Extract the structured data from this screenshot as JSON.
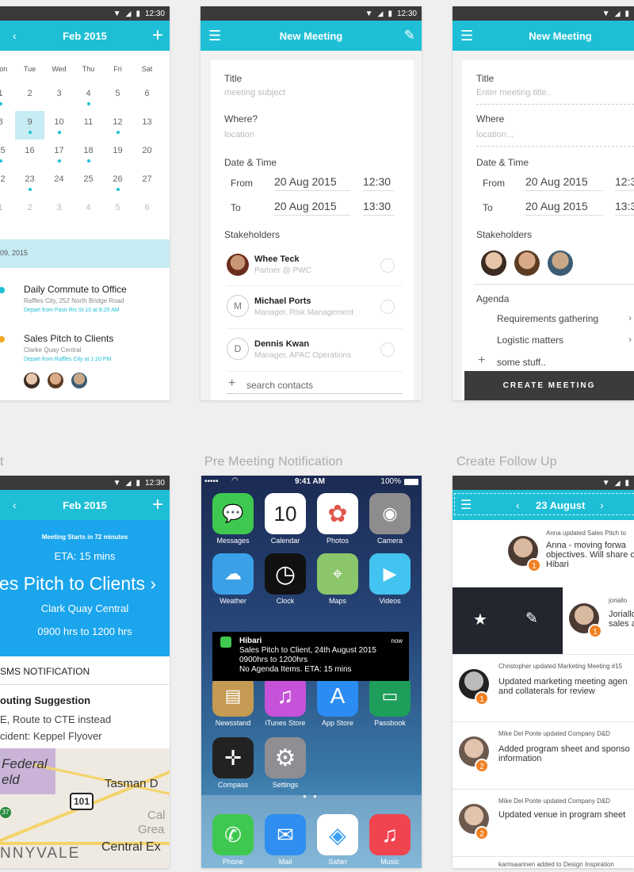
{
  "status_time": "12:30",
  "section_labels": {
    "pre_meeting": "Pre Meeting Notification",
    "follow_up": "Create Follow Up",
    "left_cut": "t"
  },
  "calendar": {
    "month": "Feb 2015",
    "weekdays": [
      "Mon",
      "Tue",
      "Wed",
      "Thu",
      "Fri",
      "Sat"
    ],
    "weeks": [
      [
        "1",
        "2",
        "3",
        "4",
        "5",
        "6"
      ],
      [
        "8",
        "9",
        "10",
        "11",
        "12",
        "13"
      ],
      [
        "15",
        "16",
        "17",
        "18",
        "19",
        "20"
      ],
      [
        "22",
        "23",
        "24",
        "25",
        "26",
        "27"
      ],
      [
        "1",
        "2",
        "3",
        "4",
        "5",
        "6"
      ]
    ],
    "date_strip": "09, 2015",
    "events": [
      {
        "title": "Daily Commute to Office",
        "address": "Raffles City, 252 North Bridge Road",
        "depart": "Depart from Pasir Ris St 10 at 8:20 AM",
        "color": "#1ebfd6"
      },
      {
        "title": "Sales Pitch to Clients",
        "address": "Clarke Quay Central",
        "depart": "Depart from Raffles City at 1:20 PM",
        "color": "#f5a623"
      }
    ]
  },
  "new_meeting_1": {
    "title": "New Meeting",
    "title_label": "Title",
    "title_placeholder": "meeting subject",
    "where_label": "Where?",
    "where_placeholder": "location",
    "datetime_label": "Date & Time",
    "from_label": "From",
    "to_label": "To",
    "from_date": "20 Aug 2015",
    "from_time": "12:30",
    "to_date": "20 Aug 2015",
    "to_time": "13:30",
    "stakeholders_label": "Stakeholders",
    "stakeholders": [
      {
        "name": "Whee Teck",
        "role": "Partner @ PWC",
        "initial": ""
      },
      {
        "name": "Michael Ports",
        "role": "Manager, Risk Management",
        "initial": "M"
      },
      {
        "name": "Dennis Kwan",
        "role": "Manager, APAC Operations",
        "initial": "D"
      }
    ],
    "search_placeholder": "search contacts"
  },
  "new_meeting_2": {
    "title": "New Meeting",
    "title_label": "Title",
    "title_placeholder": "Enter meeting title..",
    "where_label": "Where",
    "where_placeholder": "location...",
    "datetime_label": "Date & Time",
    "from_label": "From",
    "to_label": "To",
    "from_date": "20 Aug 2015",
    "from_time": "12:3",
    "to_date": "20 Aug 2015",
    "to_time": "13:3",
    "stakeholders_label": "Stakeholders",
    "agenda_label": "Agenda",
    "agenda_items": [
      "Requirements gathering",
      "Logistic matters"
    ],
    "add_item": "some stuff..",
    "create_button": "CREATE MEETING"
  },
  "alert_phone": {
    "month": "Feb 2015",
    "starts": "Meeting Starts in 72 minutes",
    "eta": "ETA: 15 mins",
    "meeting": "es Pitch to Clients",
    "location": "Clark Quay Central",
    "hours": "0900 hrs to 1200 hrs",
    "sms": "SMS NOTIFICATION",
    "routing_title": "outing Suggestion",
    "routing_1": "E, Route to CTE instead",
    "routing_2": "cident: Keppel Flyover",
    "map_labels": [
      "Federal",
      "eld",
      "Tasman D",
      "101",
      "Cal",
      "Grea",
      "NNYVALE",
      "Central Ex",
      "37"
    ]
  },
  "ios": {
    "carrier": "•••••",
    "time": "9:41 AM",
    "battery": "100%",
    "apps": [
      {
        "name": "Messages",
        "icon": "💬",
        "color": "#3fc84f"
      },
      {
        "name": "Calendar",
        "icon": "10",
        "color": "#ffffff"
      },
      {
        "name": "Photos",
        "icon": "✿",
        "color": "#ffffff"
      },
      {
        "name": "Camera",
        "icon": "◉",
        "color": "#8d8d8d"
      },
      {
        "name": "Weather",
        "icon": "☁",
        "color": "#3aa0e8"
      },
      {
        "name": "Clock",
        "icon": "◷",
        "color": "#111111"
      },
      {
        "name": "Maps",
        "icon": "⌖",
        "color": "#8cc66b"
      },
      {
        "name": "Videos",
        "icon": "▶",
        "color": "#43c3f0"
      },
      {
        "name": "Newsstand",
        "icon": "▤",
        "color": "#c59a52"
      },
      {
        "name": "iTunes Store",
        "icon": "♫",
        "color": "#c552d8"
      },
      {
        "name": "App Store",
        "icon": "A",
        "color": "#2b8df3"
      },
      {
        "name": "Passbook",
        "icon": "▭",
        "color": "#1d9e5a"
      },
      {
        "name": "Compass",
        "icon": "✛",
        "color": "#222222"
      },
      {
        "name": "Settings",
        "icon": "⚙",
        "color": "#8e8e93"
      }
    ],
    "dock": [
      {
        "name": "Phone",
        "icon": "✆",
        "color": "#3fc84f"
      },
      {
        "name": "Mail",
        "icon": "✉",
        "color": "#2f8ff0"
      },
      {
        "name": "Safari",
        "icon": "◈",
        "color": "#3ba0f5"
      },
      {
        "name": "Music",
        "icon": "♫",
        "color": "#f0444f"
      }
    ],
    "notification": {
      "app": "Hibari",
      "when": "now",
      "line1": "Sales Pitch to Client, 24th August 2015",
      "line2": "0900hrs to 1200hrs",
      "line3": "No Agenda Items. ETA: 15 mins"
    }
  },
  "follow_up": {
    "date": "23 August",
    "items": [
      {
        "meta": "Anna updated Sales Pitch to",
        "text": "Anna - moving forwa objectives. Will share on Hibari",
        "badge": "1"
      },
      {
        "meta": "joriallo",
        "text": "Joriallo sales a",
        "badge": "1"
      },
      {
        "meta": "Christopher updated Marketing Meeting #15",
        "text": "Updated marketing meeting agen and collaterals for review",
        "badge": "1"
      },
      {
        "meta": "Mike Del Ponte updated Company D&D",
        "text": "Added program sheet and sponso information",
        "badge": "2"
      },
      {
        "meta": "Mike Del Ponte updated Company D&D",
        "text": "Updated venue in program sheet",
        "badge": "2"
      },
      {
        "meta": "karrisaarinen added to Design Inspiration",
        "text": "",
        "badge": ""
      }
    ]
  }
}
